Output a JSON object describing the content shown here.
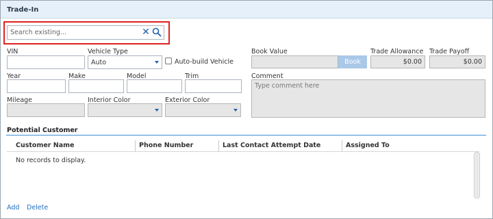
{
  "panel": {
    "title": "Trade-In"
  },
  "search": {
    "placeholder": "Search existing..."
  },
  "fields": {
    "vin_label": "VIN",
    "vehicle_type_label": "Vehicle Type",
    "vehicle_type_value": "Auto",
    "auto_build_label": "Auto-build Vehicle",
    "year_label": "Year",
    "make_label": "Make",
    "model_label": "Model",
    "trim_label": "Trim",
    "mileage_label": "Mileage",
    "interior_color_label": "Interior Color",
    "exterior_color_label": "Exterior Color",
    "book_value_label": "Book Value",
    "book_button": "Book",
    "trade_allowance_label": "Trade Allowance",
    "trade_allowance_value": "$0.00",
    "trade_payoff_label": "Trade Payoff",
    "trade_payoff_value": "$0.00",
    "comment_label": "Comment",
    "comment_placeholder": "Type comment here"
  },
  "potential_customer": {
    "title": "Potential Customer",
    "columns": [
      "Customer Name",
      "Phone Number",
      "Last Contact Attempt Date",
      "Assigned To"
    ],
    "empty_text": "No records to display.",
    "actions": {
      "add": "Add",
      "delete": "Delete"
    }
  },
  "colors": {
    "accent": "#1f5fa8",
    "highlight": "#e02020",
    "header_bg": "#e6f0fa"
  }
}
